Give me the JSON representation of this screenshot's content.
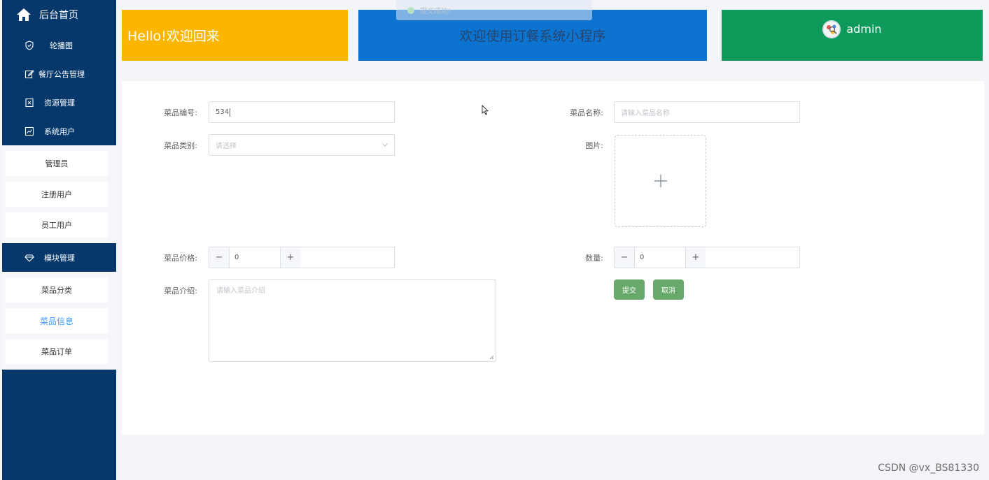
{
  "sidebar": {
    "home_label": "后台首页",
    "items": [
      {
        "label": "轮播图",
        "icon": "shield-icon"
      },
      {
        "label": "餐厅公告管理",
        "icon": "edit-icon"
      },
      {
        "label": "资源管理",
        "icon": "document-icon"
      },
      {
        "label": "系统用户",
        "icon": "chart-icon"
      }
    ],
    "user_sub": [
      "管理员",
      "注册用户",
      "员工用户"
    ],
    "module_label": "模块管理",
    "module_sub": [
      "菜品分类",
      "菜品信息",
      "菜品订单"
    ],
    "active_item": "菜品信息"
  },
  "header": {
    "hello": "Hello!欢迎回来",
    "welcome": "欢迎使用订餐系统小程序",
    "username": "admin",
    "toast": "提交成功!"
  },
  "form": {
    "code_label": "菜品编号:",
    "code_value": "534",
    "name_label": "菜品名称:",
    "name_placeholder": "请输入菜品名称",
    "category_label": "菜品类别:",
    "category_placeholder": "请选择",
    "image_label": "图片:",
    "price_label": "菜品价格:",
    "price_value": "0",
    "qty_label": "数量:",
    "qty_value": "0",
    "intro_label": "菜品介绍:",
    "intro_placeholder": "请输入菜品介绍",
    "submit_label": "提交",
    "cancel_label": "取消"
  },
  "watermark": "CSDN @vx_BS81330",
  "colors": {
    "sidebar": "#07386b",
    "hello_card": "#fdb600",
    "welcome_card": "#0d73d0",
    "user_card": "#0e9a5a",
    "button": "#67a96a",
    "active_link": "#409eff"
  }
}
